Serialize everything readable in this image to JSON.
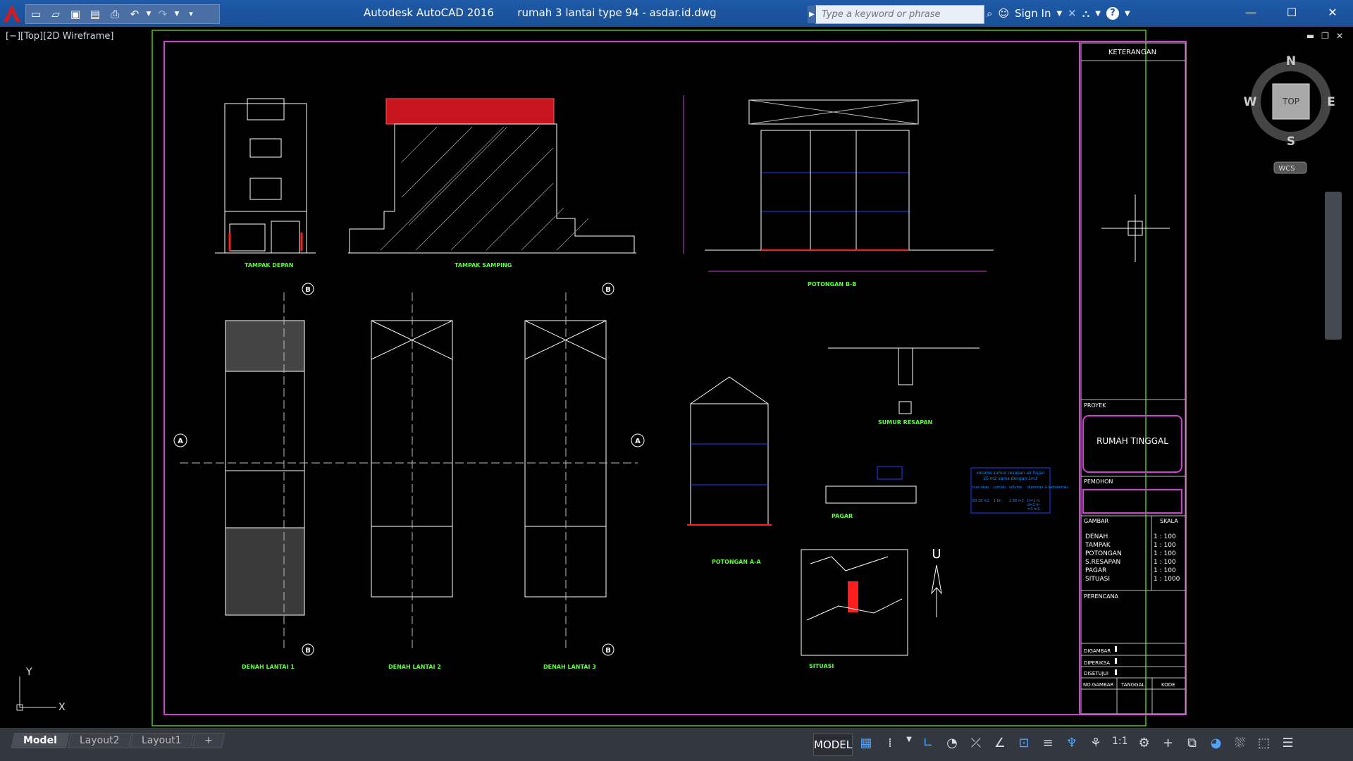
{
  "app": {
    "title": "Autodesk AutoCAD 2016",
    "document": "rumah 3 lantai type 94 - asdar.id.dwg"
  },
  "search": {
    "placeholder": "Type a keyword or phrase"
  },
  "toolbar": {
    "sign_in": "Sign In",
    "help": "?"
  },
  "window_controls": {
    "minimize": "—",
    "maximize": "☐",
    "close": "✕"
  },
  "viewport": {
    "label": "[−][Top][2D Wireframe]"
  },
  "viewcube": {
    "north": "N",
    "south": "S",
    "east": "E",
    "west": "W",
    "face": "TOP",
    "wcs": "WCS"
  },
  "ucs": {
    "y": "Y",
    "x": "X"
  },
  "drawing": {
    "titles": {
      "tampak_depan": "TAMPAK DEPAN",
      "tampak_samping": "TAMPAK SAMPING",
      "potongan_bb": "POTONGAN B-B",
      "potongan_aa": "POTONGAN A-A",
      "sumur_resapan": "SUMUR RESAPAN",
      "pagar": "PAGAR",
      "situasi": "SITUASI",
      "denah1": "DENAH LANTAI 1",
      "denah2": "DENAH LANTAI 2",
      "denah3": "DENAH LANTAI 3"
    },
    "markers": {
      "a": "A",
      "b": "B",
      "north": "U"
    },
    "water_table": {
      "header1": "volume sumur resapan air hujan",
      "header2": "25 m2 sama dengan 1m3",
      "cols": [
        "luas atap",
        "jumlah",
        "volume",
        "diameter & kedalaman"
      ],
      "row": [
        "60,18 m2",
        "1 bh",
        "2,88 m3",
        "D=1 m\nd=1 m\n=3 m3"
      ]
    }
  },
  "titleblock": {
    "keterangan": "KETERANGAN",
    "proyek": "PROYEK",
    "project_name": "RUMAH TINGGAL",
    "pemohon": "PEMOHON",
    "gambar": "GAMBAR",
    "skala": "SKALA",
    "sheets": [
      {
        "name": "DENAH",
        "scale": "1 : 100"
      },
      {
        "name": "TAMPAK",
        "scale": "1 : 100"
      },
      {
        "name": "POTONGAN",
        "scale": "1 : 100"
      },
      {
        "name": "S.RESAPAN",
        "scale": "1 : 100"
      },
      {
        "name": "PAGAR",
        "scale": "1 : 100"
      },
      {
        "name": "SITUASI",
        "scale": "1 : 1000"
      }
    ],
    "perencana": "PERENCANA",
    "digambar": "DIGAMBAR",
    "diperiksa": "DIPERIKSA",
    "disetujui": "DISETUJUI",
    "no_gambar": "NO.GAMBAR",
    "tanggal": "TANGGAL",
    "kode": "KODE"
  },
  "layout_tabs": [
    {
      "label": "Model",
      "active": true
    },
    {
      "label": "Layout2",
      "active": false
    },
    {
      "label": "Layout1",
      "active": false
    }
  ],
  "status": {
    "model": "MODEL",
    "scale": "1:1"
  },
  "colors": {
    "titlebar": "#1e5aa8",
    "frame_green": "#52c41a",
    "frame_magenta": "#d43ed4",
    "dim_red": "#ff1e1e",
    "blue_lines": "#1e3dff",
    "label_green": "#5bff3a"
  }
}
